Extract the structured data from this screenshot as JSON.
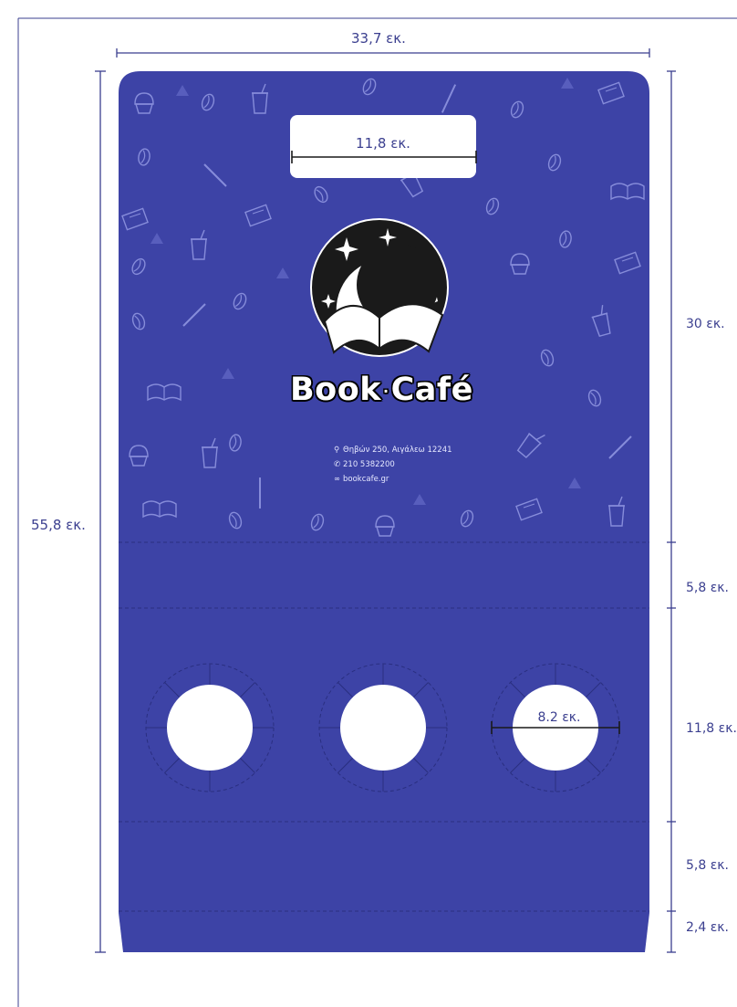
{
  "dimensions": {
    "total_width": "33,7 εκ.",
    "total_height": "55,8 εκ.",
    "handle_width": "11,8 εκ.",
    "hole_diameter": "8.2 εκ.",
    "sections": [
      "30 εκ.",
      "5,8 εκ.",
      "11,8 εκ.",
      "5,8 εκ.",
      "2,4 εκ."
    ]
  },
  "brand": {
    "name_left": "Book",
    "separator": "·",
    "name_right": "Café"
  },
  "contact": {
    "address": "Θηβών 250, Αιγάλεω 12241",
    "phone": "210 5382200",
    "website": "bookcafe.gr"
  },
  "colors": {
    "bag": "#3d43a6",
    "dimension_line": "#3b3f8f",
    "fold_line": "#2a2f80",
    "pattern": "#8f95e0"
  },
  "icons": [
    "location-pin-icon",
    "phone-icon",
    "link-icon",
    "sparkle-icon",
    "open-book-icon",
    "coffee-bean-icon",
    "cup-icon",
    "cupcake-icon",
    "straw-icon",
    "notebook-icon"
  ]
}
